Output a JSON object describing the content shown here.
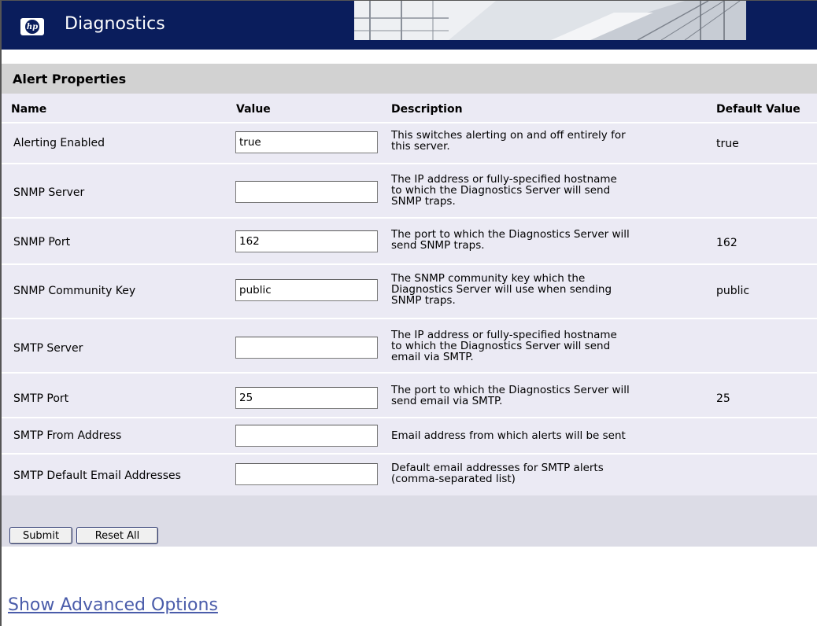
{
  "app": {
    "title": "Diagnostics",
    "logo_text": "hp"
  },
  "section": {
    "title": "Alert Properties"
  },
  "columns": {
    "name": "Name",
    "value": "Value",
    "description": "Description",
    "default": "Default Value"
  },
  "rows": [
    {
      "name": "Alerting Enabled",
      "value": "true",
      "desc": [
        "This switches alerting on and off entirely for",
        "this server."
      ],
      "default": "true"
    },
    {
      "name": "SNMP Server",
      "value": "",
      "desc": [
        "The IP address or fully-specified hostname",
        "to which the Diagnostics Server will send",
        "SNMP traps."
      ],
      "default": ""
    },
    {
      "name": "SNMP Port",
      "value": "162",
      "desc": [
        "The port to which the Diagnostics Server will",
        "send SNMP traps."
      ],
      "default": "162"
    },
    {
      "name": "SNMP Community Key",
      "value": "public",
      "desc": [
        "The SNMP community key which the",
        "Diagnostics Server will use when sending",
        "SNMP traps."
      ],
      "default": "public"
    },
    {
      "name": "SMTP Server",
      "value": "",
      "desc": [
        "The IP address or fully-specified hostname",
        "to which the Diagnostics Server will send",
        "email via SMTP."
      ],
      "default": ""
    },
    {
      "name": "SMTP Port",
      "value": "25",
      "desc": [
        "The port to which the Diagnostics Server will",
        "send email via SMTP."
      ],
      "default": "25"
    },
    {
      "name": "SMTP From Address",
      "value": "",
      "desc": [
        "Email address from which alerts will be sent"
      ],
      "default": ""
    },
    {
      "name": "SMTP Default Email Addresses",
      "value": "",
      "desc": [
        "Default email addresses for SMTP alerts",
        "(comma-separated list)"
      ],
      "default": ""
    }
  ],
  "buttons": {
    "submit": "Submit",
    "reset": "Reset All"
  },
  "links": {
    "advanced": "Show Advanced Options"
  },
  "colors": {
    "header_bg": "#0a1d5c",
    "section_bg": "#d2d2d2",
    "table_bg": "#ebeaf4",
    "link": "#4a5caa"
  }
}
